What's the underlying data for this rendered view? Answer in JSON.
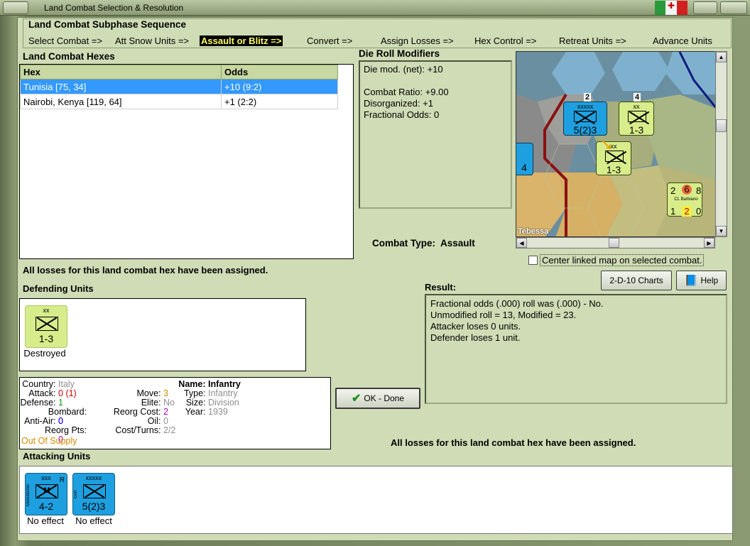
{
  "window": {
    "title": "Land Combat Selection & Resolution"
  },
  "sequence": {
    "heading": "Land Combat Subphase Sequence",
    "steps": [
      "Select Combat =>",
      "Att Snow Units =>",
      "Assault or Blitz =>",
      "Convert =>",
      "Assign Losses =>",
      "Hex Control =>",
      "Retreat Units =>",
      "Advance Units"
    ],
    "active_index": 2
  },
  "hexes": {
    "heading": "Land Combat Hexes",
    "columns": [
      "Hex",
      "Odds"
    ],
    "rows": [
      {
        "hex": "Tunisia [75, 34]",
        "odds": "+10 (9:2)"
      },
      {
        "hex": "Nairobi, Kenya [119, 64]",
        "odds": "+1 (2:2)"
      }
    ]
  },
  "modifiers": {
    "heading": "Die Roll Modifiers",
    "lines": [
      "Die mod. (net): +10",
      "",
      "Combat Ratio: +9.00",
      "Disorganized: +1",
      "Fractional Odds: 0"
    ]
  },
  "combat_type": {
    "label": "Combat Type:",
    "value": "Assault"
  },
  "map": {
    "place_label": "Tebessa",
    "counters": [
      {
        "size": "xxxxx",
        "side": "Gort",
        "strength": "5(2)3",
        "stack": "2"
      },
      {
        "size": "xx",
        "strength": "1-3",
        "stack": "4"
      },
      {
        "size": "xx",
        "strength": "1-3"
      },
      {
        "strength": "4"
      }
    ],
    "ship": {
      "name": "CL Barbiano",
      "top": [
        "2",
        "6",
        "8"
      ],
      "bottom": [
        "1",
        "2",
        "0"
      ]
    }
  },
  "center_map": {
    "label": "Center linked map on selected combat.",
    "checked": false
  },
  "losses_note_top": "All losses for this land combat hex have been assigned.",
  "buttons": {
    "charts": "2-D-10 Charts",
    "help": "Help",
    "ok": "OK - Done"
  },
  "defending": {
    "heading": "Defending Units",
    "units": [
      {
        "size": "xx",
        "strength": "1-3",
        "status": "Destroyed",
        "color": "#d7ec8a"
      }
    ]
  },
  "result": {
    "heading": "Result:",
    "lines": [
      "Fractional odds (.000) roll was (.000)  - No.",
      "Unmodified roll = 13, Modified = 23.",
      "Attacker loses 0 units.",
      "Defender loses 1 unit."
    ]
  },
  "unit_info": {
    "country_label": "Country:",
    "country": "Italy",
    "attack_label": "Attack:",
    "attack": "0",
    "attack_mod": "(1)",
    "defense_label": "Defense:",
    "defense": "1",
    "bombard_label": "Bombard:",
    "bombard": "0",
    "antiair_label": "Anti-Air:",
    "antiair": "0",
    "reorgpts_label": "Reorg Pts:",
    "reorgpts": "0",
    "supply": "Out Of Supply",
    "move_label": "Move:",
    "move": "3",
    "elite_label": "Elite:",
    "elite": "No",
    "reorgcost_label": "Reorg Cost:",
    "reorgcost": "2",
    "oil_label": "Oil:",
    "oil": "0",
    "costturns_label": "Cost/Turns:",
    "costturns": "2/2",
    "name_label": "Name:",
    "name": "Infantry",
    "type_label": "Type:",
    "type": "Infantry",
    "size_label": "Size:",
    "size": "Division",
    "year_label": "Year:",
    "year": "1939"
  },
  "losses_note_bottom": "All losses for this land combat hex have been assigned.",
  "attacking": {
    "heading": "Attacking Units",
    "units": [
      {
        "size": "xxx",
        "side": "Manchester",
        "flag": "R",
        "symbol": "M",
        "strength": "4-2",
        "status": "No effect",
        "color": "#1ea0e0"
      },
      {
        "size": "xxxxx",
        "side": "Gort",
        "strength": "5(2)3",
        "status": "No effect",
        "color": "#1ea0e0"
      }
    ]
  },
  "colors": {
    "client": "#cfdcb5",
    "selection": "#3399ff",
    "active_step_bg": "#000000",
    "active_step_fg": "#ffff66",
    "allied_counter": "#1ea0e0",
    "italian_counter": "#d7ec8a"
  }
}
